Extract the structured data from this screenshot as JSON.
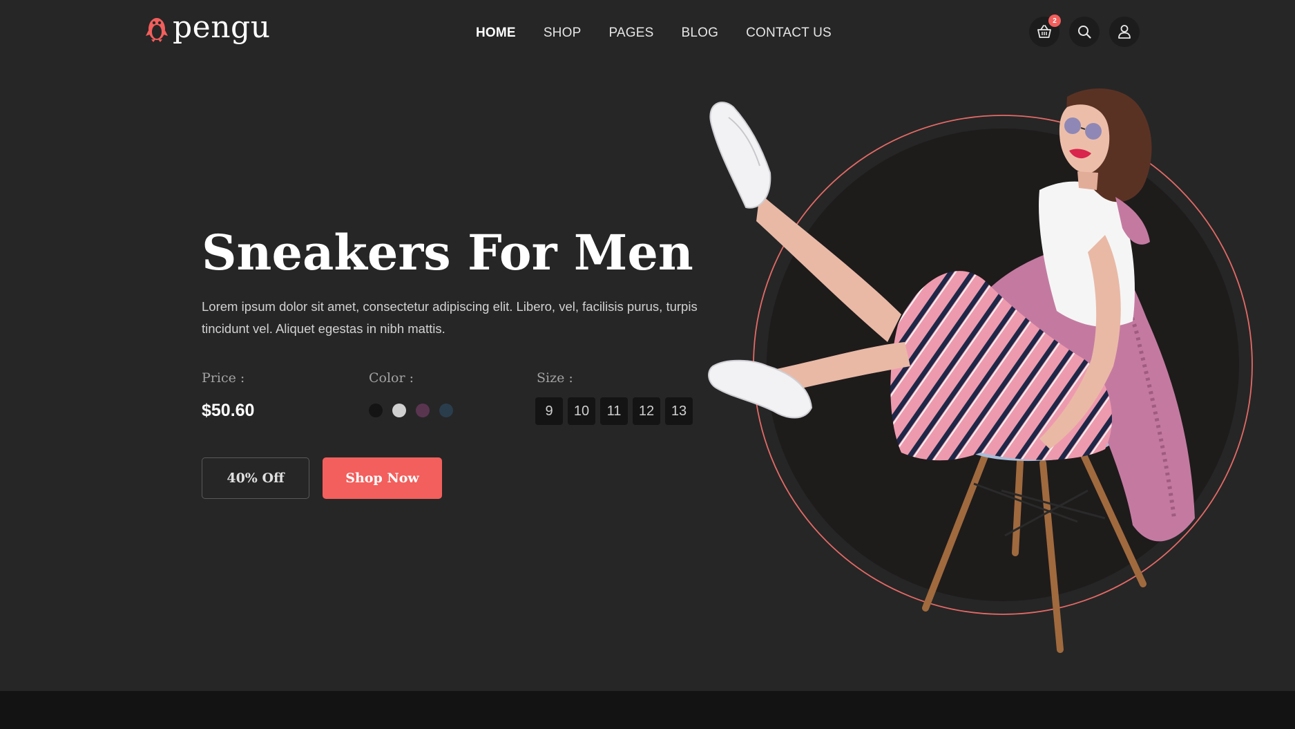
{
  "brand": {
    "name": "pengu",
    "accent": "#f25f5c"
  },
  "nav": {
    "items": [
      {
        "label": "HOME",
        "active": true
      },
      {
        "label": "SHOP"
      },
      {
        "label": "PAGES"
      },
      {
        "label": "BLOG"
      },
      {
        "label": "CONTACT US"
      }
    ]
  },
  "header_icons": {
    "cart": {
      "icon": "basket-icon",
      "badge": "2"
    },
    "search": {
      "icon": "search-icon"
    },
    "account": {
      "icon": "user-icon"
    }
  },
  "hero": {
    "title": "Sneakers For Men",
    "description": "Lorem ipsum dolor sit amet, consectetur adipiscing elit. Libero, vel, facilisis purus, turpis tincidunt vel. Aliquet egestas in nibh mattis.",
    "price_label": "Price :",
    "price": "$50.60",
    "color_label": "Color :",
    "colors": [
      "#141414",
      "#d0d0d0",
      "#5a3550",
      "#2a3d4c"
    ],
    "size_label": "Size :",
    "sizes": [
      "9",
      "10",
      "11",
      "12",
      "13"
    ],
    "discount_button": "40% Off",
    "shop_button": "Shop Now"
  }
}
